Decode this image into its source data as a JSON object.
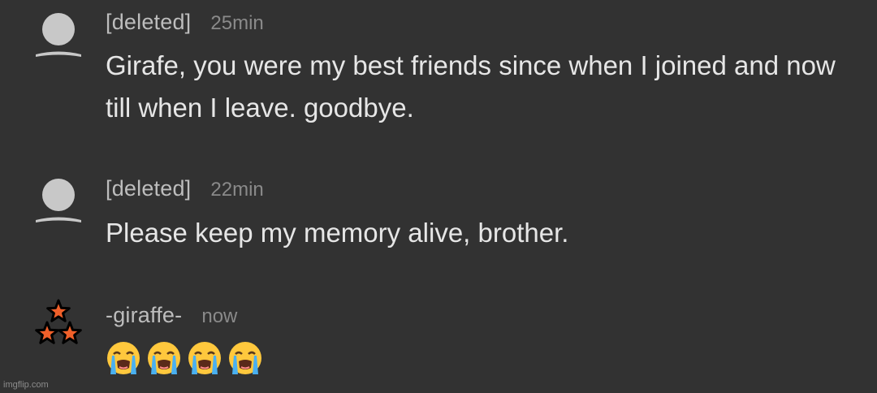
{
  "comments": [
    {
      "username": "[deleted]",
      "time": "25min",
      "text": "Girafe, you were my best friends since when I joined and now till when I leave. goodbye.",
      "avatar": "default-user-icon"
    },
    {
      "username": "[deleted]",
      "time": "22min",
      "text": "Please keep my memory alive, brother.",
      "avatar": "default-user-icon"
    },
    {
      "username": "-giraffe-",
      "time": "now",
      "emojis": [
        "loudly-crying-face",
        "loudly-crying-face",
        "loudly-crying-face",
        "loudly-crying-face"
      ],
      "avatar": "three-stars-icon"
    }
  ],
  "watermark": "imgflip.com",
  "colors": {
    "background": "#323232",
    "username": "#bdbdbd",
    "timestamp": "#8a8a8a",
    "text": "#e6e6e6",
    "avatar": "#c8c8c8",
    "star_fill": "#f0602a"
  }
}
